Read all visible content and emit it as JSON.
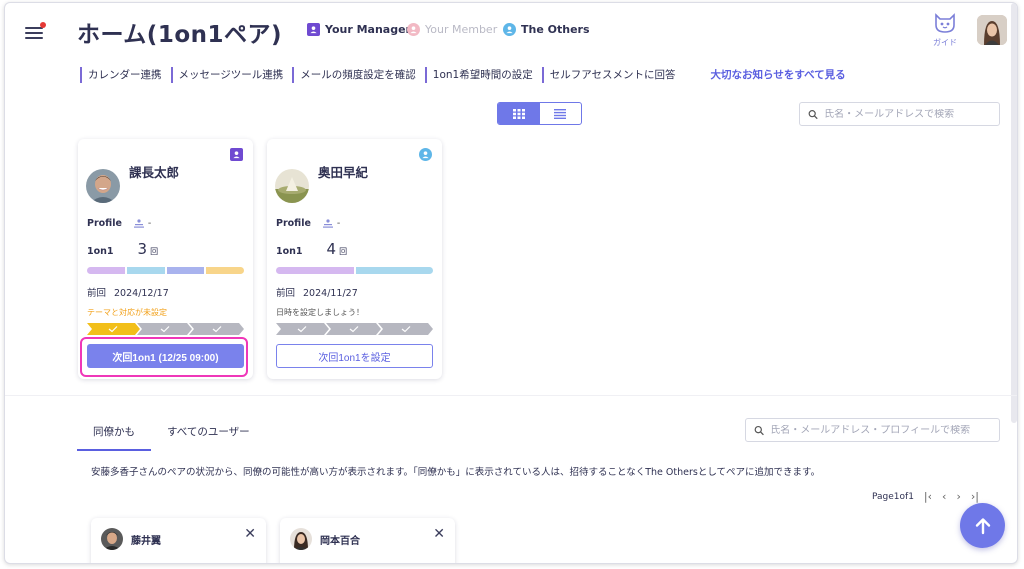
{
  "header": {
    "title": "ホーム(1on1ペア)",
    "legend": {
      "manager": "Your Manager",
      "member": "Your Member",
      "others": "The Others"
    },
    "guide_label": "ガイド"
  },
  "subnav": {
    "items": [
      "カレンダー連携",
      "メッセージツール連携",
      "メールの頻度設定を確認",
      "1on1希望時間の設定",
      "セルフアセスメントに回答"
    ],
    "notice": "大切なお知らせをすべて見る"
  },
  "search": {
    "top_placeholder": "氏名・メールアドレスで検索",
    "bottom_placeholder": "氏名・メールアドレス・プロフィールで検索"
  },
  "cards": [
    {
      "name": "課長太郎",
      "profile_label": "Profile",
      "profile_value": "-",
      "oneonone_label": "1on1",
      "count": "3",
      "count_unit": "回",
      "prev_label": "前回",
      "prev_date": "2024/12/17",
      "note": "テーマと対応が未設定",
      "button": "次回1on1 (12/25 09:00)",
      "bar_colors": [
        "#d5b8f0",
        "#a8d8ee",
        "#a9b3ee",
        "#f8d58a"
      ]
    },
    {
      "name": "奥田早紀",
      "profile_label": "Profile",
      "profile_value": "-",
      "oneonone_label": "1on1",
      "count": "4",
      "count_unit": "回",
      "prev_label": "前回",
      "prev_date": "2024/11/27",
      "note": "日時を設定しましょう！",
      "button": "次回1on1を設定",
      "bar_colors": [
        "#d5b8f0",
        "#a8d8ee"
      ]
    }
  ],
  "tabs": [
    "同僚かも",
    "すべてのユーザー"
  ],
  "description": "安藤多香子さんのペアの状況から、同僚の可能性が高い方が表示されます。「同僚かも」に表示されている人は、招待することなくThe Othersとしてペアに追加できます。",
  "pager": {
    "text": "Page1of1",
    "first": "|‹",
    "prev": "‹",
    "next": "›",
    "last": "›|"
  },
  "users": [
    "藤井翼",
    "岡本百合"
  ],
  "colors": {
    "accent": "#6f78e8",
    "manager": "#6f4ad1",
    "others": "#5eb6e8",
    "warning": "#f2a11a",
    "highlight": "#ef37b9"
  }
}
